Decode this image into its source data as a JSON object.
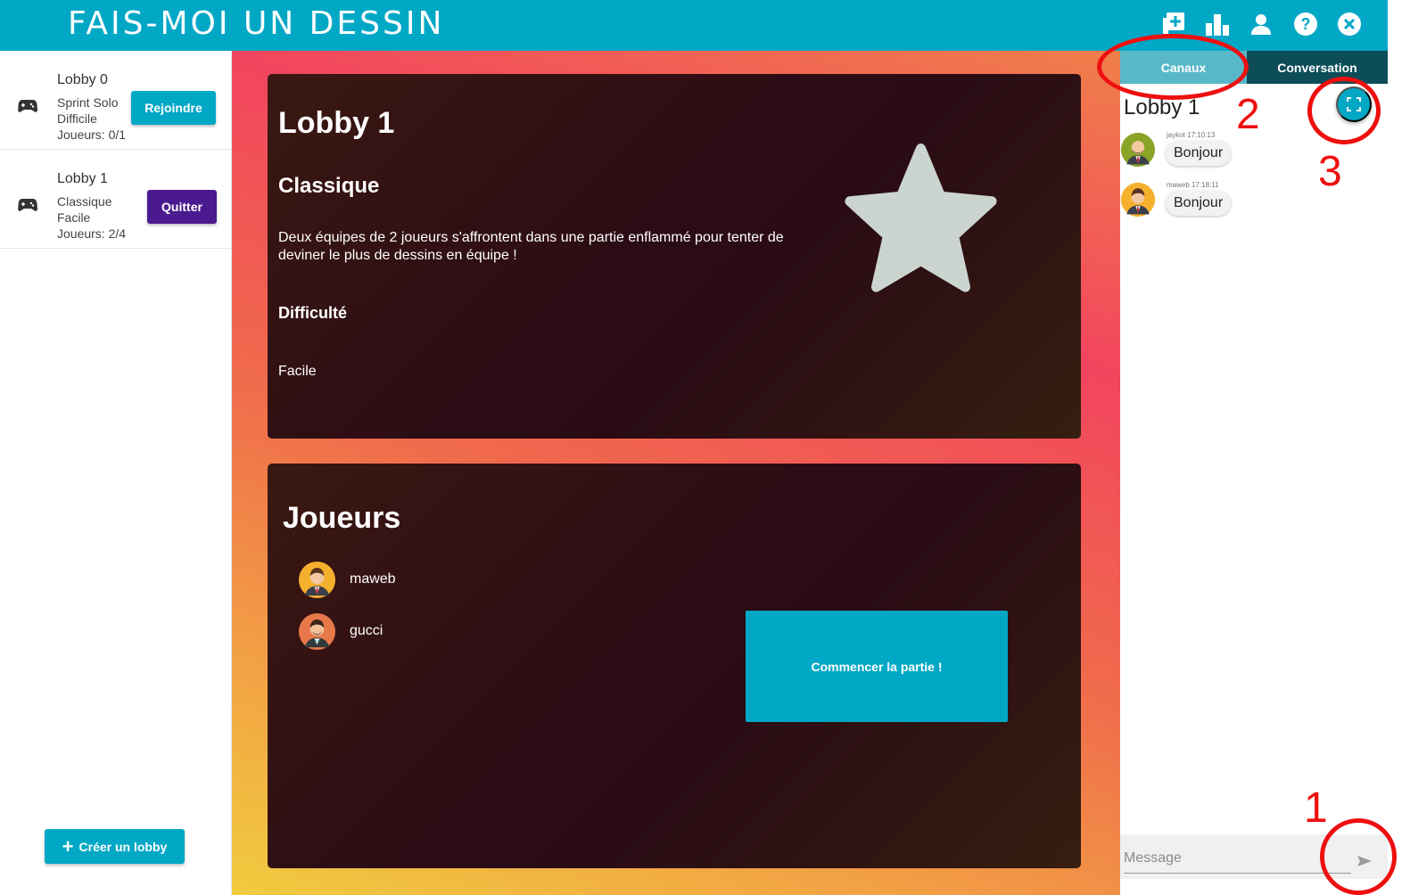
{
  "header": {
    "title": "FAIS-MOI UN DESSIN",
    "icons": [
      "add-lobby-icon",
      "stats-icon",
      "profile-icon",
      "help-icon",
      "close-icon"
    ]
  },
  "sidebar": {
    "lobbies": [
      {
        "name": "Lobby 0",
        "mode": "Sprint Solo",
        "difficulty": "Difficile",
        "players": "Joueurs: 0/1",
        "action": "Rejoindre"
      },
      {
        "name": "Lobby 1",
        "mode": "Classique",
        "difficulty": "Facile",
        "players": "Joueurs: 2/4",
        "action": "Quitter"
      }
    ],
    "create_label": "Créer un lobby"
  },
  "lobby": {
    "title": "Lobby 1",
    "mode": "Classique",
    "description": "Deux équipes de 2 joueurs s'affrontent dans une partie enflammé pour tenter de deviner le plus de dessins en équipe !",
    "difficulty_label": "Difficulté",
    "difficulty_value": "Facile"
  },
  "players_panel": {
    "title": "Joueurs",
    "players": [
      {
        "name": "maweb"
      },
      {
        "name": "gucci"
      }
    ],
    "start_label": "Commencer la partie !"
  },
  "chat": {
    "tabs": [
      "Canaux",
      "Conversation"
    ],
    "active_tab": "Canaux",
    "channel_title": "Lobby 1",
    "messages": [
      {
        "meta": "jaykot 17:10:13",
        "text": "Bonjour"
      },
      {
        "meta": "maweb 17:18:11",
        "text": "Bonjour"
      }
    ],
    "input_placeholder": "Message"
  },
  "annotations": [
    "1",
    "2",
    "3"
  ],
  "colors": {
    "primary": "#00a8c6",
    "quit": "#4a1a8e",
    "tab_active": "#58b8c8",
    "tab_inactive": "#0c4d58",
    "annotation": "#ee0f0f"
  }
}
